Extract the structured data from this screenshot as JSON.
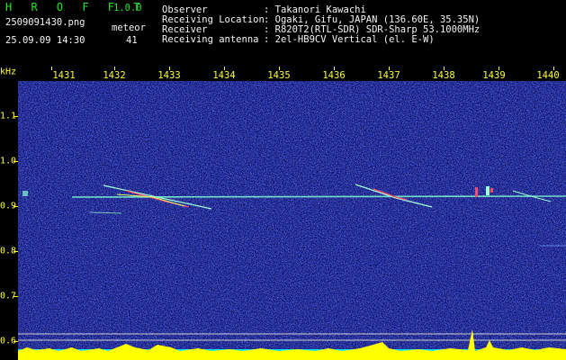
{
  "header": {
    "app_name": "H R O F F T",
    "version": "1.0.0",
    "filename": "2509091430.png",
    "datetime": "25.09.09 14:30",
    "meteor_label": "meteor",
    "meteor_count": "41",
    "observer_label": "Observer",
    "observer_value": ": Takanori Kawachi",
    "location_label": "Receiving Location",
    "location_value": ": Ogaki, Gifu, JAPAN (136.60E, 35.35N)",
    "receiver_label": "Receiver",
    "receiver_value": ": R820T2(RTL-SDR) SDR-Sharp 53.1000MHz",
    "antenna_label": "Receiving antenna",
    "antenna_value": ": 2el-HB9CV Vertical (el. E-W)"
  },
  "axes": {
    "y_unit": "kHz",
    "x_ticks": [
      "1431",
      "1432",
      "1433",
      "1434",
      "1435",
      "1436",
      "1437",
      "1438",
      "1439",
      "1440"
    ],
    "y_ticks": [
      "1.1",
      "1.0",
      "0.9",
      "0.8",
      "0.7",
      "0.6"
    ]
  },
  "colors": {
    "background": "#000000",
    "header_green": "#22e622",
    "header_white": "#f4f4f4",
    "axis_yellow": "#ffff33",
    "noise_blue": "#1a1f9a",
    "carrier_cyan": "#7fffd0",
    "level_yellow": "#ffff00",
    "level_cyan": "#00e5ff"
  }
}
